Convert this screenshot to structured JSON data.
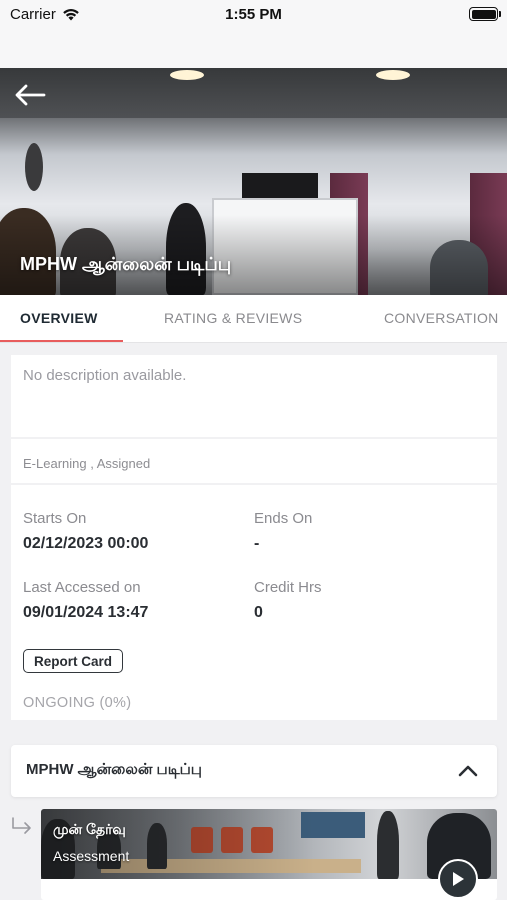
{
  "status_bar": {
    "carrier": "Carrier",
    "time": "1:55 PM"
  },
  "header": {
    "back_icon": "arrow-left-icon",
    "course_title": "MPHW ஆன்லைன் படிப்பு"
  },
  "tabs": [
    {
      "label": "OVERVIEW",
      "active": true
    },
    {
      "label": "RATING & REVIEWS",
      "active": false
    },
    {
      "label": "CONVERSATION",
      "active": false
    }
  ],
  "overview": {
    "description": "No description available.",
    "tags": "E-Learning , Assigned",
    "starts_on_label": "Starts On",
    "starts_on_value": "02/12/2023 00:00",
    "ends_on_label": "Ends On",
    "ends_on_value": "-",
    "last_accessed_label": "Last Accessed on",
    "last_accessed_value": "09/01/2024 13:47",
    "credit_hrs_label": "Credit Hrs",
    "credit_hrs_value": "0",
    "report_card_label": "Report Card",
    "status": "ONGOING (0%)"
  },
  "module": {
    "title": "MPHW ஆன்லைன் படிப்பு",
    "expanded": true,
    "toggle_icon": "chevron-up-icon"
  },
  "lesson": {
    "title": "முன் தேர்வு",
    "type": "Assessment",
    "play_icon": "play-icon"
  },
  "colors": {
    "accent": "#e85d5d",
    "dark": "#2c3338",
    "background": "#f1f1f3"
  }
}
